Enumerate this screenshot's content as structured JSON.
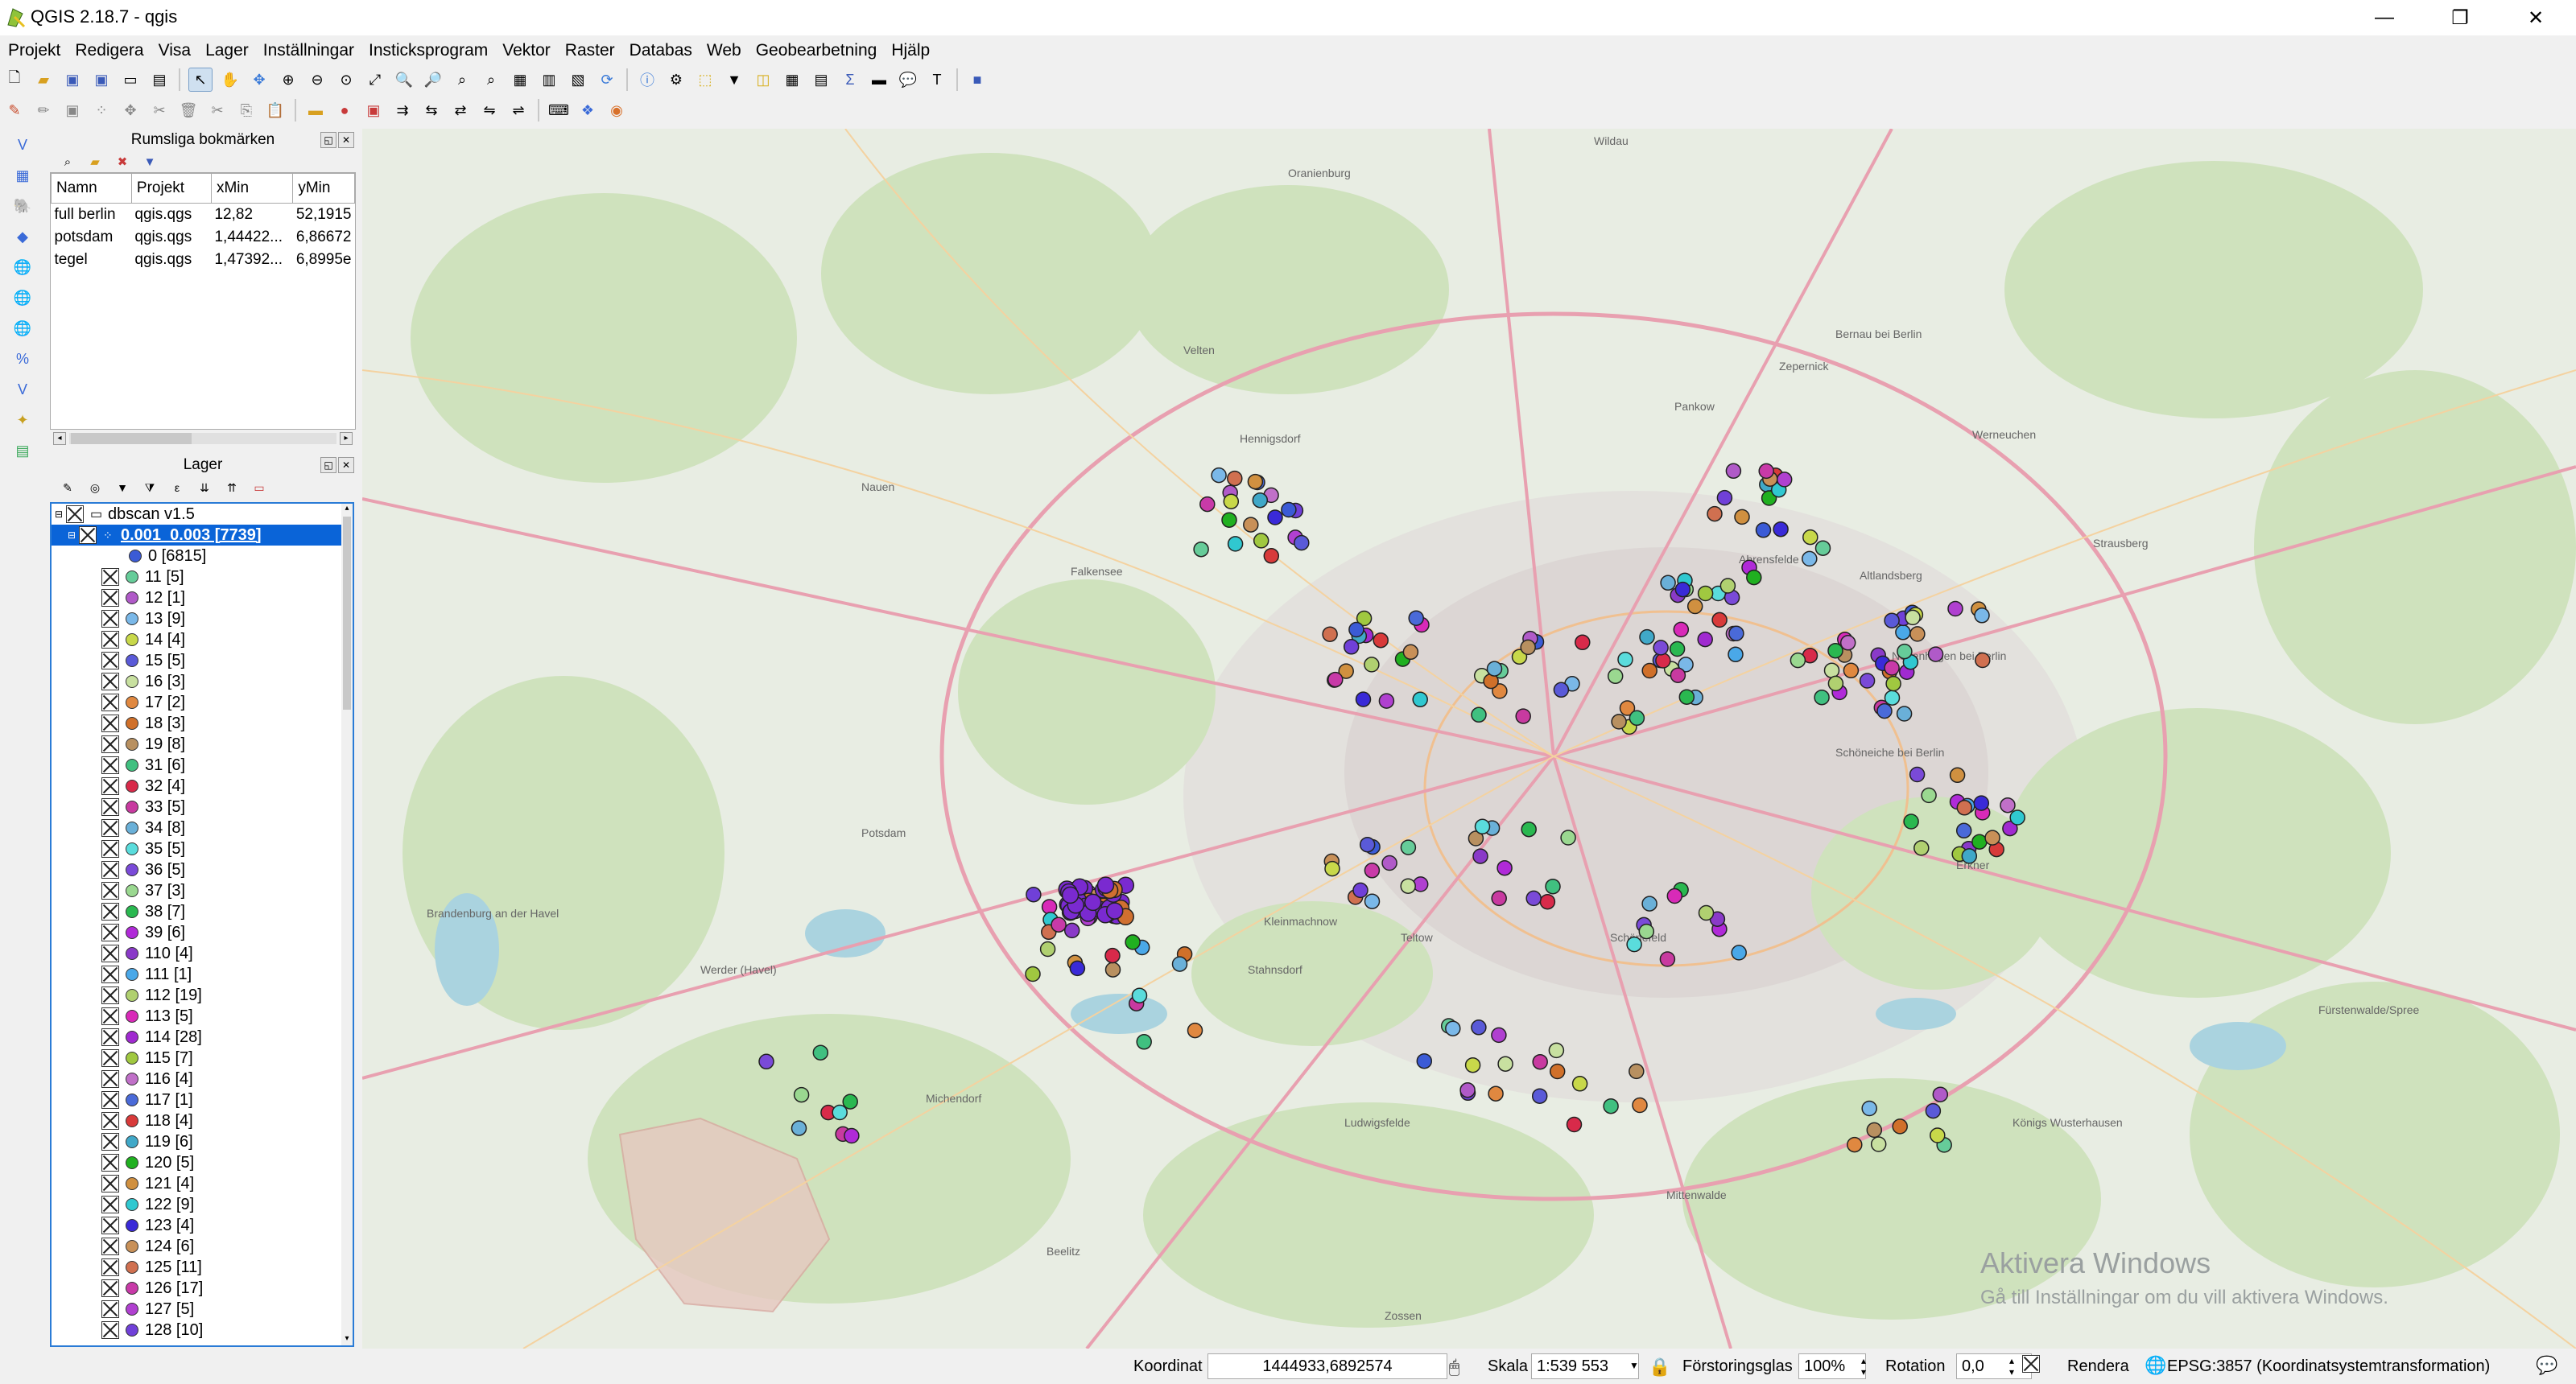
{
  "window": {
    "title": "QGIS 2.18.7 - qgis",
    "minimize_glyph": "—",
    "restore_glyph": "❐",
    "close_glyph": "✕"
  },
  "menu": [
    "Projekt",
    "Redigera",
    "Visa",
    "Lager",
    "Inställningar",
    "Insticksprogram",
    "Vektor",
    "Raster",
    "Databas",
    "Web",
    "Geobearbetning",
    "Hjälp"
  ],
  "bookmarks": {
    "title": "Rumsliga bokmärken",
    "columns": [
      "Namn",
      "Projekt",
      "xMin",
      "yMin"
    ],
    "rows": [
      [
        "full berlin",
        "qgis.qgs",
        "12,82",
        "52,1915"
      ],
      [
        "potsdam",
        "qgis.qgs",
        "1,44422...",
        "6,86672"
      ],
      [
        "tegel",
        "qgis.qgs",
        "1,47392...",
        "6,8995e"
      ]
    ]
  },
  "layers": {
    "title": "Lager",
    "group": "dbscan v1.5",
    "layer": "0.001_0.003 [7739]",
    "items": [
      {
        "label": "0 [6815]",
        "color": "#3b5bd6"
      },
      {
        "label": "11 [5]",
        "color": "#66cc99"
      },
      {
        "label": "12 [1]",
        "color": "#b05ac8"
      },
      {
        "label": "13 [9]",
        "color": "#7ab8e8"
      },
      {
        "label": "14 [4]",
        "color": "#c8d84a"
      },
      {
        "label": "15 [5]",
        "color": "#5a5ad8"
      },
      {
        "label": "16 [3]",
        "color": "#c8e0a0"
      },
      {
        "label": "17 [2]",
        "color": "#e08840"
      },
      {
        "label": "18 [3]",
        "color": "#d0702a"
      },
      {
        "label": "19 [8]",
        "color": "#b89060"
      },
      {
        "label": "31 [6]",
        "color": "#40c080"
      },
      {
        "label": "32 [4]",
        "color": "#d82a4a"
      },
      {
        "label": "33 [5]",
        "color": "#c83aa0"
      },
      {
        "label": "34 [8]",
        "color": "#6ab0d8"
      },
      {
        "label": "35 [5]",
        "color": "#5adcdc"
      },
      {
        "label": "36 [5]",
        "color": "#7a4ad8"
      },
      {
        "label": "37 [3]",
        "color": "#9ad890"
      },
      {
        "label": "38 [7]",
        "color": "#2ab850"
      },
      {
        "label": "39 [6]",
        "color": "#b02ad8"
      },
      {
        "label": "110 [4]",
        "color": "#8a3ac8"
      },
      {
        "label": "111 [1]",
        "color": "#4aa8e8"
      },
      {
        "label": "112 [19]",
        "color": "#b0d070"
      },
      {
        "label": "113 [5]",
        "color": "#d82ab8"
      },
      {
        "label": "114 [28]",
        "color": "#a02ad0"
      },
      {
        "label": "115 [7]",
        "color": "#a0c840"
      },
      {
        "label": "116 [4]",
        "color": "#c070c8"
      },
      {
        "label": "117 [1]",
        "color": "#4a6ad8"
      },
      {
        "label": "118 [4]",
        "color": "#d83a3a"
      },
      {
        "label": "119 [6]",
        "color": "#40a8c8"
      },
      {
        "label": "120 [5]",
        "color": "#20b020"
      },
      {
        "label": "121 [4]",
        "color": "#d09040"
      },
      {
        "label": "122 [9]",
        "color": "#30c8d0"
      },
      {
        "label": "123 [4]",
        "color": "#3a2ad8"
      },
      {
        "label": "124 [6]",
        "color": "#c89058"
      },
      {
        "label": "125 [11]",
        "color": "#d07050"
      },
      {
        "label": "126 [17]",
        "color": "#c83aa8"
      },
      {
        "label": "127 [5]",
        "color": "#b040d0"
      },
      {
        "label": "128 [10]",
        "color": "#7040d8"
      }
    ]
  },
  "map": {
    "watermark_title": "Aktivera Windows",
    "watermark_sub": "Gå till Inställningar om du vill aktivera Windows.",
    "places": [
      "Wildau",
      "Oranienburg",
      "Bernau bei Berlin",
      "Zepernick",
      "Pankow",
      "Werneuchen",
      "Falkensee",
      "Nauen",
      "Ahrensfelde",
      "Altlandsberg",
      "Neuenhagen bei Berlin",
      "Schöneiche bei Berlin",
      "Potsdam",
      "Stahnsdorf",
      "Kleinmachnow",
      "Teltow",
      "Schönefeld",
      "Werder (Havel)",
      "Brandenburg an der Havel",
      "Michendorf",
      "Ludwigsfelde",
      "Königs Wusterhausen",
      "Mittenwalde",
      "Erkner",
      "Fürstenwalde/Spree",
      "Strausberg",
      "Hennigsdorf",
      "Velten",
      "Beelitz",
      "Zossen"
    ]
  },
  "status": {
    "coord_label": "Koordinat",
    "coord_value": "1444933,6892574",
    "scale_label": "Skala",
    "scale_value": "1:539 553",
    "magnifier_label": "Förstoringsglas",
    "magnifier_value": "100%",
    "rotation_label": "Rotation",
    "rotation_value": "0,0",
    "render_label": "Rendera",
    "crs": "EPSG:3857 (Koordinatsystemtransformation)"
  }
}
